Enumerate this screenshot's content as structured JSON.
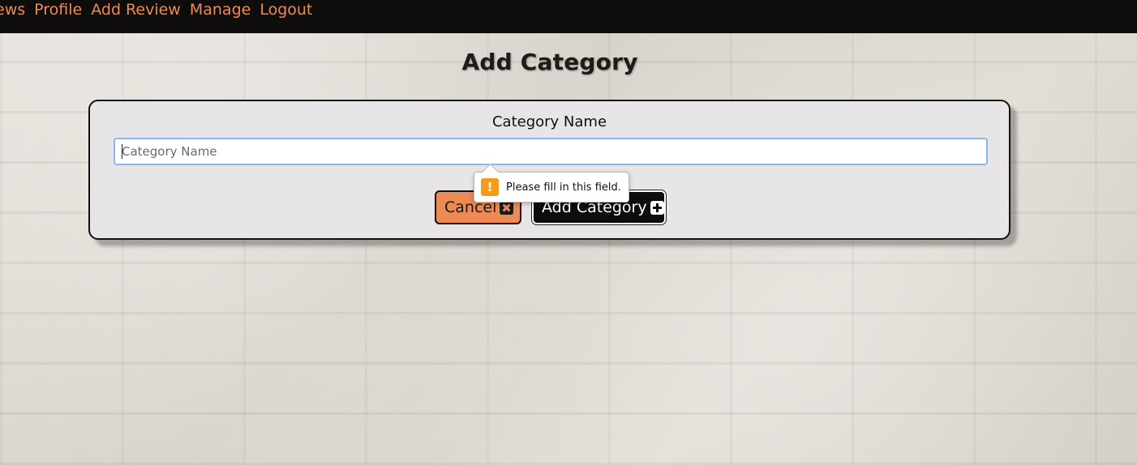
{
  "nav": {
    "items": [
      {
        "label": "ews"
      },
      {
        "label": "Profile"
      },
      {
        "label": "Add Review"
      },
      {
        "label": "Manage"
      },
      {
        "label": "Logout"
      }
    ]
  },
  "page": {
    "title": "Add Category"
  },
  "form": {
    "field_label": "Category Name",
    "input_value": "",
    "input_placeholder": "Category Name",
    "cancel_label": "Cancel",
    "submit_label": "Add Category"
  },
  "validation": {
    "message": "Please fill in this field.",
    "icon_text": "!"
  },
  "colors": {
    "accent": "#ee8a53",
    "nav_bg": "#0f0d0b",
    "card_bg": "#e8e5e6",
    "warning": "#f49b1c"
  },
  "icons": {
    "cancel": "close-icon",
    "submit": "plus-square-icon",
    "validation": "warning-icon"
  }
}
